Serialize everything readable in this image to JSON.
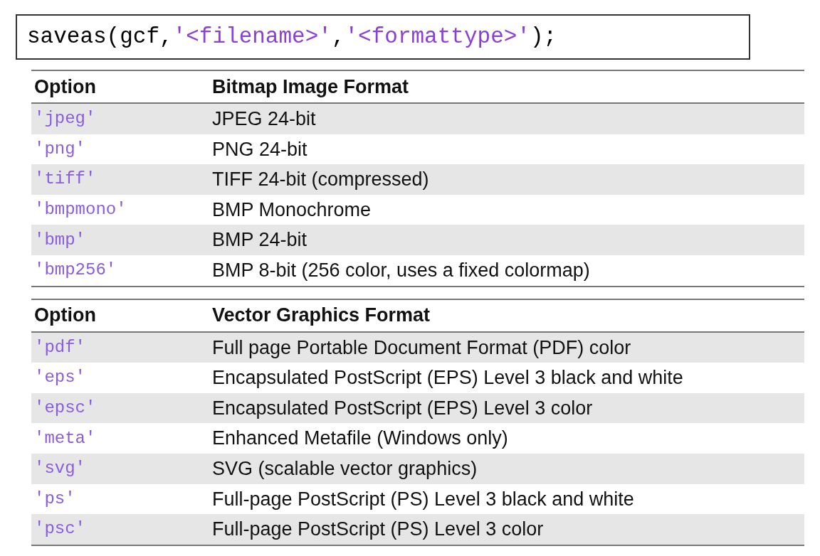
{
  "code": [
    {
      "kind": "plain",
      "text": "saveas(gcf,"
    },
    {
      "kind": "string",
      "text": "'<filename>'"
    },
    {
      "kind": "plain",
      "text": ","
    },
    {
      "kind": "string",
      "text": "'<formattype>'"
    },
    {
      "kind": "plain",
      "text": ");"
    }
  ],
  "tables": [
    {
      "columns": [
        "Option",
        "Bitmap Image Format"
      ],
      "rows": [
        {
          "option": "'jpeg'",
          "description": "JPEG 24-bit"
        },
        {
          "option": "'png'",
          "description": "PNG 24-bit"
        },
        {
          "option": "'tiff'",
          "description": "TIFF 24-bit (compressed)"
        },
        {
          "option": "'bmpmono'",
          "description": "BMP Monochrome"
        },
        {
          "option": "'bmp'",
          "description": "BMP 24-bit"
        },
        {
          "option": "'bmp256'",
          "description": "BMP 8-bit (256 color, uses a fixed colormap)"
        }
      ]
    },
    {
      "columns": [
        "Option",
        "Vector Graphics Format"
      ],
      "rows": [
        {
          "option": "'pdf'",
          "description": "Full page Portable Document Format (PDF) color"
        },
        {
          "option": "'eps'",
          "description": "Encapsulated PostScript (EPS) Level 3 black and white"
        },
        {
          "option": "'epsc'",
          "description": "Encapsulated PostScript (EPS) Level 3 color"
        },
        {
          "option": "'meta'",
          "description": "Enhanced Metafile (Windows only)"
        },
        {
          "option": "'svg'",
          "description": "SVG (scalable vector graphics)"
        },
        {
          "option": "'ps'",
          "description": "Full-page PostScript (PS) Level 3 black and white"
        },
        {
          "option": "'psc'",
          "description": "Full-page PostScript (PS) Level 3 color"
        }
      ]
    }
  ]
}
